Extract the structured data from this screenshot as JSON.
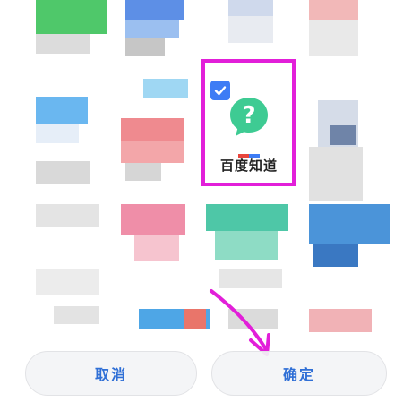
{
  "dialog": {
    "selected_app": {
      "label": "百度知道",
      "checked": true,
      "icon": "question-mark-bubble-icon",
      "icon_color": "#3ecb93",
      "highlight_color": "#e21fd9"
    },
    "annotation_arrow_color": "#e21fd9"
  },
  "buttons": {
    "cancel_label": "取消",
    "confirm_label": "确定",
    "label_color": "#2f6fd6"
  },
  "colors": {
    "checkbox": "#3d7cf5"
  }
}
